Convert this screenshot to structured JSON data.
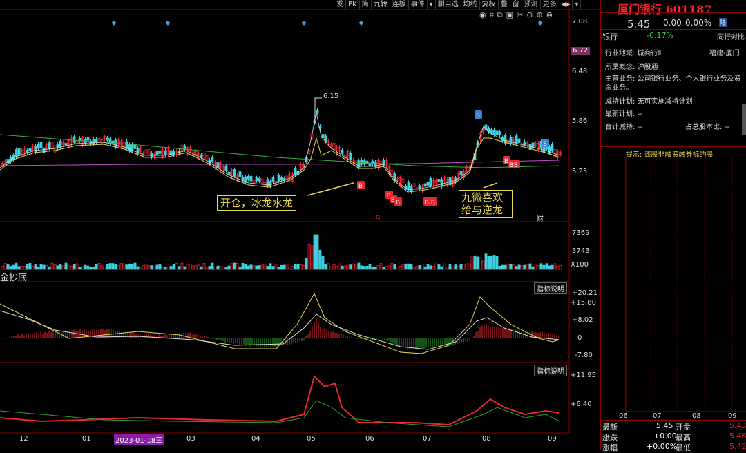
{
  "toolbar": [
    "发",
    "PK",
    "简",
    "九转",
    "连板",
    "事件",
    "▾",
    "删自选",
    "均线",
    "复权",
    "叠",
    "窗",
    "预测",
    "更多",
    "◀▸",
    "▾"
  ],
  "price_axis": [
    "7.08",
    "6.48",
    "5.86",
    "5.25"
  ],
  "price_axis_highlight": "6.72",
  "high_marker": "6.15",
  "callouts": {
    "left": "开仓，冰龙水龙",
    "right_line1": "九微喜欢",
    "right_line2": "给与逆龙"
  },
  "markers": {
    "q": "q",
    "cai": "财",
    "s": "S",
    "b": "B"
  },
  "volume_axis": [
    "7369",
    "3743",
    "X100"
  ],
  "indicator1": {
    "name": "金抄底",
    "button": "指标说明",
    "axis": [
      "+20.21",
      "+15.80",
      "+8.02",
      "0",
      "-7.80"
    ]
  },
  "indicator2": {
    "button": "指标说明",
    "axis": [
      "+11.95",
      "+6.40"
    ]
  },
  "time_axis": [
    "12",
    "01",
    "03",
    "04",
    "05",
    "06",
    "07",
    "08",
    "09"
  ],
  "time_cursor": "2023-01-18三",
  "stock": {
    "name": "厦门银行",
    "code": "601187",
    "price": "5.45",
    "change": "0.00",
    "pct": "0.00%",
    "board": "陆"
  },
  "sector": {
    "name": "银行",
    "pct": "-0.17%",
    "compare": "同行对比"
  },
  "info": {
    "industry_key": "行业地域:",
    "industry_val": "城商行Ⅱ",
    "region": "福建-厦门",
    "concept_key": "所属概念:",
    "concept_val": "沪股通",
    "business_key": "主营业务:",
    "business_val1": "公司银行业务、个人银行业务及资",
    "business_val2": "金业务。",
    "reduce_key": "减持计划:",
    "reduce_val": "无可实施减持计划",
    "latest_key": "最新计划:",
    "latest_val": "--",
    "total_key": "合计减持:",
    "total_val": "--",
    "ratio_key": "占总股本比:",
    "ratio_val": "--"
  },
  "tip": "提示: 该股非融资融券标的股",
  "mini_axis": [
    "06",
    "07",
    "08",
    "09"
  ],
  "quote": [
    {
      "k1": "最新",
      "v1": "5.45",
      "k2": "开盘",
      "v2": "5.43"
    },
    {
      "k1": "涨跌",
      "v1": "+0.00",
      "k2": "最高",
      "v2": "5.46"
    },
    {
      "k1": "涨幅",
      "v1": "+0.00%",
      "k2": "最低",
      "v2": "5.42"
    }
  ],
  "colors": {
    "up": "#e8262e",
    "down": "#3fd0e0",
    "ma_yellow": "#e8d84a",
    "ma_green": "#3cb043",
    "ma_purple": "#c050c0"
  }
}
